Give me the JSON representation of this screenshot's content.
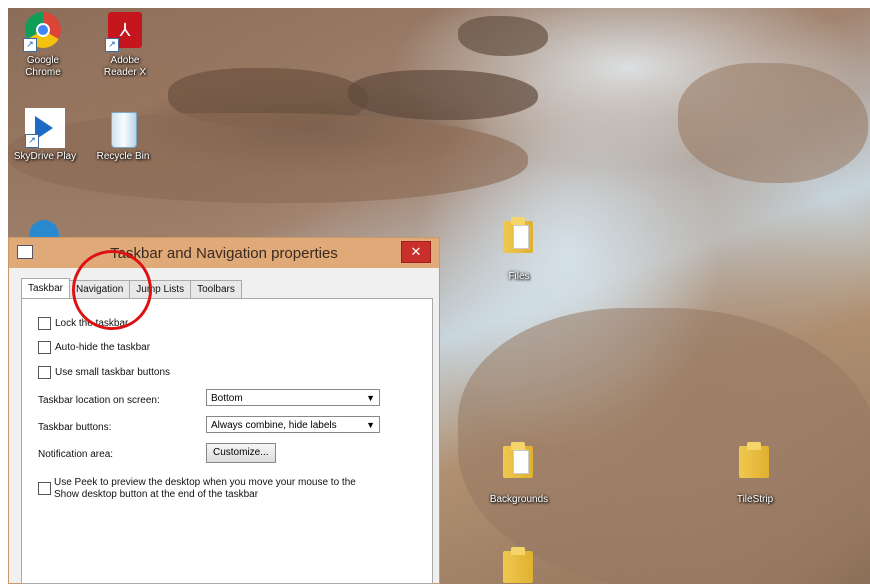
{
  "desktop_icons": [
    {
      "label1": "Google",
      "label2": "Chrome",
      "icon": "chrome-icon"
    },
    {
      "label1": "Adobe",
      "label2": "Reader X",
      "icon": "adobe-reader-icon"
    },
    {
      "label1": "SkyDrive Play",
      "label2": "",
      "icon": "media-play-icon"
    },
    {
      "label1": "Recycle Bin",
      "label2": "",
      "icon": "recycle-bin-icon"
    },
    {
      "label1": "Files",
      "label2": "",
      "icon": "folder-icon"
    },
    {
      "label1": "Backgrounds",
      "label2": "",
      "icon": "folder-icon"
    },
    {
      "label1": "TileStrip",
      "label2": "",
      "icon": "folder-icon"
    }
  ],
  "dialog": {
    "title": "Taskbar and Navigation properties",
    "close_symbol": "✕",
    "tabs": [
      "Taskbar",
      "Navigation",
      "Jump Lists",
      "Toolbars"
    ],
    "active_tab": "Taskbar",
    "checkboxes": [
      "Lock the taskbar",
      "Auto-hide the taskbar",
      "Use small taskbar buttons"
    ],
    "location_label": "Taskbar location on screen:",
    "location_value": "Bottom",
    "buttons_label": "Taskbar buttons:",
    "buttons_value": "Always combine, hide labels",
    "notification_label": "Notification area:",
    "customize_label": "Customize...",
    "peek_label_line1": "Use Peek to preview the desktop when you move your mouse to the",
    "peek_label_line2": "Show desktop button at the end of the taskbar"
  },
  "annotation": {
    "color": "#dd1111",
    "target": "Navigation"
  }
}
